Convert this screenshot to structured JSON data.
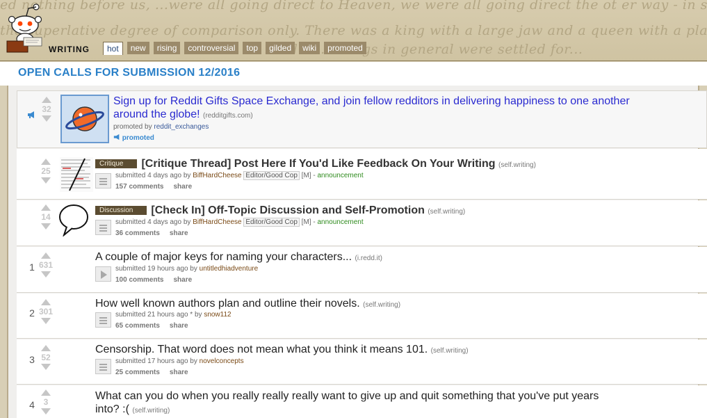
{
  "header": {
    "script_lines": [
      "ed nothing before us, ...were all going direct to Heaven, we were all going  direct the ot er way - in short, the period was",
      "the superlative degree of comparison only.  There was a king with a large jaw and a queen with a plain face, on  the throne of",
      "                                                            ...rid  ...   ...things in general were settled for..."
    ],
    "subreddit_title": "WRITING",
    "tabs": [
      {
        "label": "hot",
        "active": true
      },
      {
        "label": "new"
      },
      {
        "label": "rising"
      },
      {
        "label": "controversial"
      },
      {
        "label": "top"
      },
      {
        "label": "gilded"
      },
      {
        "label": "wiki"
      },
      {
        "label": "promoted"
      }
    ]
  },
  "banner": {
    "text": "OPEN CALLS FOR SUBMISSION 12/2016"
  },
  "posts": [
    {
      "rank": "",
      "score": "32",
      "title": "Sign up for Reddit Gifts Space Exchange, and join fellow redditors in delivering happiness to one another",
      "title_line2": "around the globe!",
      "domain": "redditgifts.com",
      "meta_prefix": "promoted by",
      "user": "reddit_exchanges",
      "promoted_label": "promoted",
      "thumb_icon": "planet-icon"
    },
    {
      "rank": "",
      "score": "25",
      "flair": "Critique",
      "title": "[Critique Thread] Post Here If You'd Like Feedback On Your Writing",
      "domain": "self.writing",
      "meta_prefix": "submitted 4 days ago by",
      "user": "BiffHardCheese",
      "user_flair": "Editor/Good Cop",
      "mod": "[M]",
      "separator": "-",
      "tag": "announcement",
      "comments": "157 comments",
      "share": "share",
      "thumb_icon": "manuscript-icon"
    },
    {
      "rank": "",
      "score": "14",
      "flair": "Discussion",
      "title": "[Check In] Off-Topic Discussion and Self-Promotion",
      "domain": "self.writing",
      "meta_prefix": "submitted 4 days ago by",
      "user": "BiffHardCheese",
      "user_flair": "Editor/Good Cop",
      "mod": "[M]",
      "separator": "-",
      "tag": "announcement",
      "comments": "36 comments",
      "share": "share",
      "thumb_icon": "speech-bubble-icon"
    },
    {
      "rank": "1",
      "score": "631",
      "title": "A couple of major keys for naming your characters...",
      "domain": "i.redd.it",
      "meta_prefix": "submitted 19 hours ago by",
      "user": "untitledhiadventure",
      "comments": "100 comments",
      "share": "share"
    },
    {
      "rank": "2",
      "score": "301",
      "title": "How well known authors plan and outline their novels.",
      "domain": "self.writing",
      "meta_prefix": "submitted 21 hours ago * by",
      "user": "snow112",
      "comments": "65 comments",
      "share": "share"
    },
    {
      "rank": "3",
      "score": "52",
      "title": "Censorship. That word does not mean what you think it means 101.",
      "domain": "self.writing",
      "meta_prefix": "submitted 17 hours ago by",
      "user": "novelconcepts",
      "comments": "25 comments",
      "share": "share"
    },
    {
      "rank": "4",
      "score": "3",
      "title": "What can you do when you really really really want to give up and quit something that you've put years",
      "title_line2": "into? :(",
      "domain": "self.writing"
    }
  ],
  "colors": {
    "accent": "#2a80c8",
    "header_bg": "#d7ccae",
    "tab_bg": "#9b8a6a",
    "flair_bg": "#5b4c31"
  }
}
